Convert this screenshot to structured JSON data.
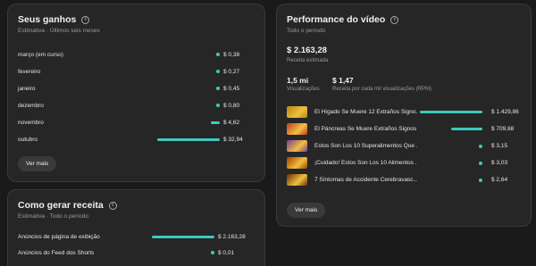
{
  "earnings": {
    "title": "Seus ganhos",
    "subtitle": "Estimativa · Últimos seis meses",
    "rows": [
      {
        "label": "março (em curso)",
        "value": "$ 0,38",
        "fraction": 0.012
      },
      {
        "label": "fevereiro",
        "value": "$ 0,27",
        "fraction": 0.008
      },
      {
        "label": "janeiro",
        "value": "$ 0,45",
        "fraction": 0.014
      },
      {
        "label": "dezembro",
        "value": "$ 0,80",
        "fraction": 0.024
      },
      {
        "label": "novembro",
        "value": "$ 4,62",
        "fraction": 0.14
      },
      {
        "label": "outubro",
        "value": "$ 32,94",
        "fraction": 1.0
      }
    ],
    "button": "Ver mais"
  },
  "revenue": {
    "title": "Como gerar receita",
    "subtitle": "Estimativa · Todo o período",
    "rows": [
      {
        "label": "Anúncios de página de exibição",
        "value": "$ 2.163,28",
        "fraction": 1.0
      },
      {
        "label": "Anúncios do Feed dos Shorts",
        "value": "$ 0,01",
        "fraction": 0.0
      }
    ]
  },
  "performance": {
    "title": "Performance do vídeo",
    "subtitle": "Todo o período",
    "total_value": "$ 2.163,28",
    "total_label": "Receita estimada",
    "views_value": "1,5 mi",
    "views_label": "Visualizações",
    "rpm_value": "$ 1,47",
    "rpm_label": "Receita por cada mil visualizações (RPM)",
    "videos": [
      {
        "title": "El Hígado Se Muere 12 Extraños Signo...",
        "value": "$ 1.429,86",
        "fraction": 1.0,
        "thumb_color": "#b8860b"
      },
      {
        "title": "El Páncreas Se Muere Extraños Signos ...",
        "value": "$ 709,68",
        "fraction": 0.5,
        "thumb_color": "#c0392b"
      },
      {
        "title": "Estos Son Los 10 Superalimentos Que ...",
        "value": "$ 3,15",
        "fraction": 0.002,
        "thumb_color": "#7d3c98"
      },
      {
        "title": "¡Cuidado! Estos Son Los 10 Alimentos ...",
        "value": "$ 3,03",
        "fraction": 0.002,
        "thumb_color": "#a04000"
      },
      {
        "title": "7 Síntomas de Accidente Cerebravasc...",
        "value": "$ 2,64",
        "fraction": 0.002,
        "thumb_color": "#6e2c00"
      }
    ],
    "button": "Ver mais"
  },
  "colors": {
    "accent": "#3ec8c0",
    "card": "#262626",
    "background": "#1a1a1a"
  },
  "icons": {
    "info": "info-icon",
    "thumbnail": "video-thumbnail"
  }
}
